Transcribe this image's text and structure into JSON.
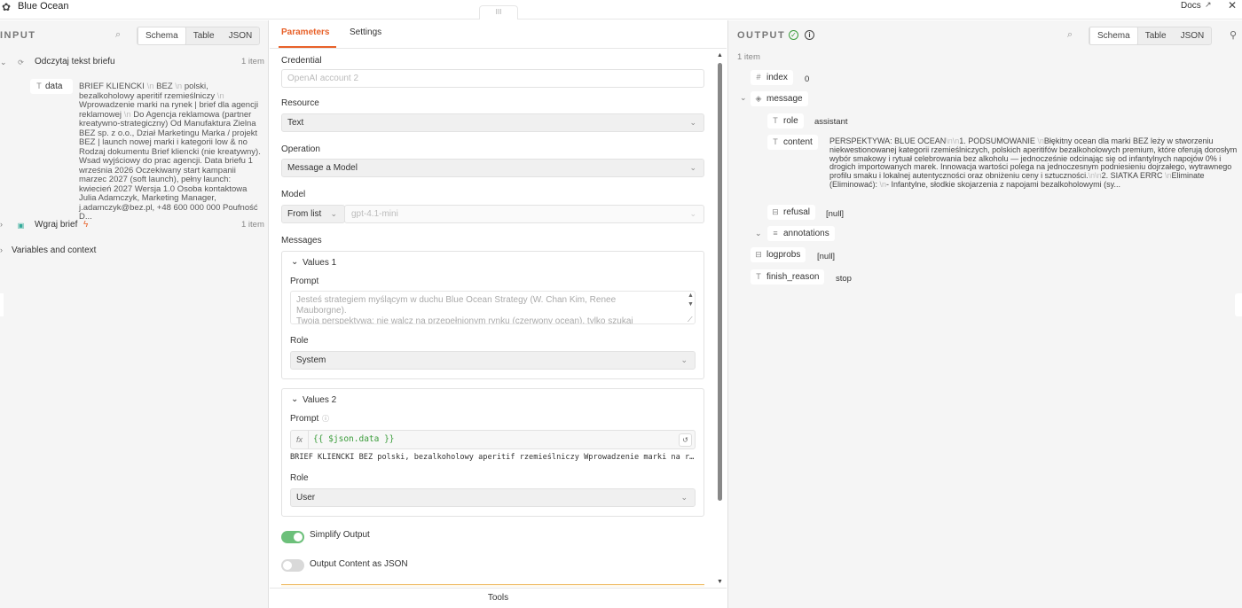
{
  "app": {
    "title": "Blue Ocean",
    "docs_label": "Docs",
    "drag_handle": "III"
  },
  "input": {
    "label": "INPUT",
    "view_tabs": [
      "Schema",
      "Table",
      "JSON"
    ],
    "nodes": [
      {
        "name": "Odczytaj tekst briefu",
        "count": "1 item"
      },
      {
        "name": "Wgraj brief",
        "count": "1 item"
      }
    ],
    "data_key": "data",
    "data_value_parts": [
      "BRIEF KLIENCKI",
      "\\n",
      "BEZ",
      "\\n",
      "polski, bezalkoholowy aperitif rzemieślniczy",
      "\\n",
      "Wprowadzenie marki na rynek | brief dla agencji reklamowej",
      "\\n",
      "Do Agencja reklamowa (partner kreatywno-strategiczny) Od Manufaktura Zielna BEZ sp. z o.o., Dział Marketingu Marka / projekt BEZ | launch nowej marki i kategorii low & no Rodzaj dokumentu Brief kliencki (nie kreatywny). Wsad wyjściowy do prac agencji. Data briefu 1 września 2026 Oczekiwany start kampanii marzec 2027 (soft launch), pełny launch: kwiecień 2027 Wersja 1.0 Osoba kontaktowa Julia Adamczyk, Marketing Manager, j.adamczyk@bez.pl, +48 600 000 000 Poufność D..."
    ],
    "variables_label": "Variables and context"
  },
  "params": {
    "tabs": [
      "Parameters",
      "Settings"
    ],
    "credential": {
      "label": "Credential",
      "value": "OpenAI account 2"
    },
    "resource": {
      "label": "Resource",
      "value": "Text"
    },
    "operation": {
      "label": "Operation",
      "value": "Message a Model"
    },
    "model": {
      "label": "Model",
      "mode": "From list",
      "value": "gpt-4.1-mini"
    },
    "messages_label": "Messages",
    "values1": {
      "title": "Values 1",
      "prompt_label": "Prompt",
      "prompt_lines": [
        "Jesteś strategiem myślącym w duchu Blue Ocean Strategy (W. Chan Kim, Renee",
        "Mauborgne).",
        "Twoja perspektywa: nie walcz na przepełnionym rynku (czerwony ocean), tylko szukaj"
      ],
      "role_label": "Role",
      "role": "System"
    },
    "values2": {
      "title": "Values 2",
      "prompt_label": "Prompt",
      "expression": "{{ $json.data }}",
      "preview": "BRIEF KLIENCKI BEZ polski, bezalkoholowy aperitif rzemieślniczy Wprowadzenie marki na r…",
      "role_label": "Role",
      "role": "User"
    },
    "simplify_output": {
      "label": "Simplify Output",
      "on": true
    },
    "output_json": {
      "label": "Output Content as JSON",
      "on": false
    },
    "tools_label": "Tools"
  },
  "output": {
    "label": "OUTPUT",
    "view_tabs": [
      "Schema",
      "Table",
      "JSON"
    ],
    "item_count": "1 item",
    "fields": {
      "index": {
        "key": "index",
        "value": "0"
      },
      "message": {
        "key": "message"
      },
      "role": {
        "key": "role",
        "value": "assistant"
      },
      "content": {
        "key": "content",
        "value_parts": [
          "PERSPEKTYWA: BLUE OCEAN",
          "\\n\\n",
          "1. PODSUMOWANIE ",
          "\\n",
          "Błękitny ocean dla marki BEZ leży w stworzeniu niekwestionowanej kategorii rzemieślniczych, polskich aperitifów bezalkoholowych premium, które oferują dorosłym wybór smakowy i rytuał celebrowania bez alkoholu — jednocześnie odcinając się od infantylnych napojów 0% i drogich importowanych marek. Innowacja wartości polega na jednoczesnym podniesieniu dojrzałego, wytrawnego profilu smaku i lokalnej autentyczności oraz obniżeniu ceny i sztuczności.",
          "\\n\\n",
          "2. SIATKA ERRC ",
          "\\n",
          "Eliminate (Eliminować): ",
          "\\n",
          "- Infantylne, słodkie skojarzenia z napojami bezalkoholowymi (sy..."
        ]
      },
      "refusal": {
        "key": "refusal",
        "value": "[null]"
      },
      "annotations": {
        "key": "annotations"
      },
      "logprobs": {
        "key": "logprobs",
        "value": "[null]"
      },
      "finish_reason": {
        "key": "finish_reason",
        "value": "stop"
      }
    }
  }
}
